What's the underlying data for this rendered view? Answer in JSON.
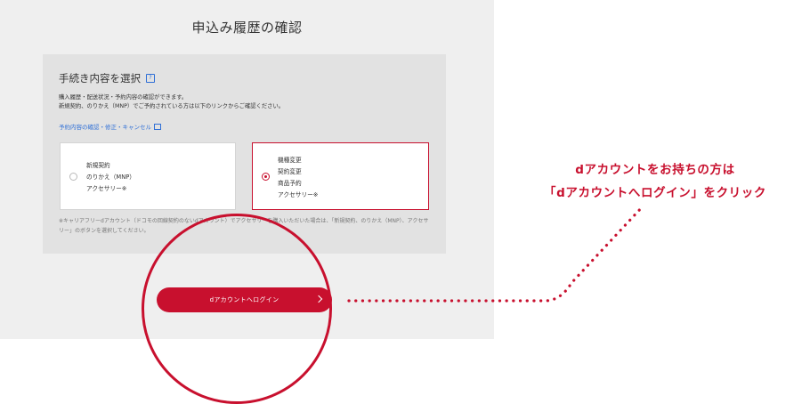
{
  "page": {
    "title": "申込み履歴の確認"
  },
  "panel": {
    "heading": "手続き内容を選択",
    "info_icon": "help-icon",
    "description": [
      "購入履歴・配送状況・予約内容の確認ができます。",
      "新規契約、のりかえ（MNP）でご予約されている方は以下のリンクからご確認ください。"
    ],
    "link_label": "予約内容の確認・修正・キャンセル",
    "options": [
      {
        "lines": [
          "新規契約",
          "のりかえ（MNP）",
          "アクセサリー※"
        ],
        "selected": false
      },
      {
        "lines": [
          "機種変更",
          "契約変更",
          "商品予約",
          "アクセサリー※"
        ],
        "selected": true
      }
    ],
    "note": "※キャリアフリーdアカウント（ドコモの回線契約のないdアカウント）でアクセサリーを購入いただいた場合は、「新規契約、のりかえ（MNP）、アクセサリー」のボタンを選択してください。"
  },
  "login_button": {
    "label": "dアカウントへログイン"
  },
  "callout": {
    "lines": [
      "dアカウントをお持ちの方は",
      "「dアカウントへログイン」をクリック"
    ],
    "color": "#c8102e"
  },
  "colors": {
    "accent": "#c8102e",
    "link": "#2f6fd6",
    "background": "#efefef",
    "panel": "#e2e2e2"
  }
}
